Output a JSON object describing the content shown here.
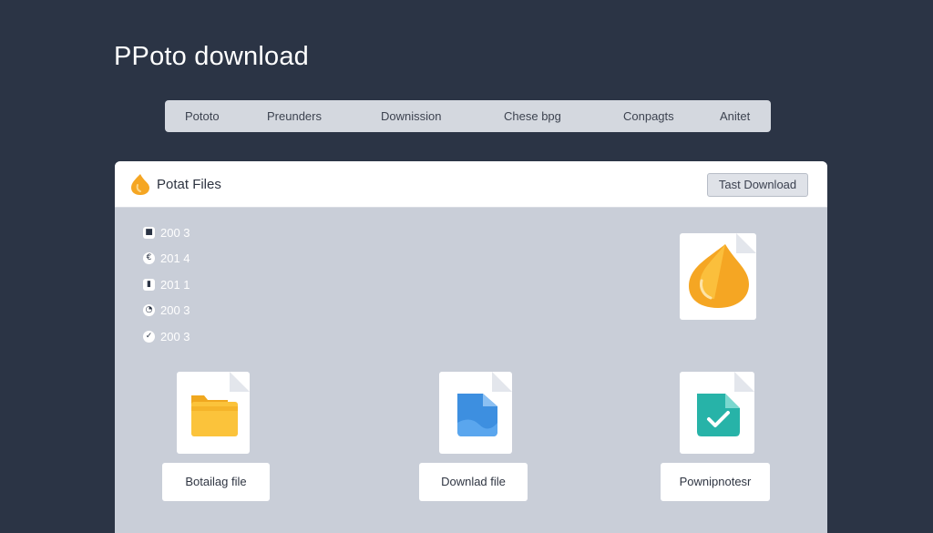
{
  "page": {
    "title": "PPoto download"
  },
  "nav": {
    "items": [
      {
        "label": "Pototo"
      },
      {
        "label": "Preunders"
      },
      {
        "label": "Downission"
      },
      {
        "label": "Chese bpg"
      },
      {
        "label": "Conpagts"
      },
      {
        "label": "Anitet"
      }
    ]
  },
  "panel": {
    "title": "Potat Files",
    "header_icon": "flame-icon",
    "action_label": "Tast Download",
    "years": [
      {
        "label": "200 3",
        "icon": "stop-icon"
      },
      {
        "label": "201 4",
        "icon": "euro-icon"
      },
      {
        "label": "201 1",
        "icon": "lock-icon"
      },
      {
        "label": "200 3",
        "icon": "clock-icon"
      },
      {
        "label": "200 3",
        "icon": "check-icon"
      }
    ],
    "preview_icon": "flame-icon",
    "files": [
      {
        "icon": "folder-icon",
        "label": "Botailag file"
      },
      {
        "icon": "document-icon",
        "label": "Downlad file"
      },
      {
        "icon": "check-file-icon",
        "label": "Pownipnotesr"
      }
    ]
  },
  "colors": {
    "background": "#2b3445",
    "panel": "#c9ced8",
    "accent_orange": "#f5a623",
    "accent_blue": "#3d8fe0",
    "accent_teal": "#27b3a8"
  }
}
